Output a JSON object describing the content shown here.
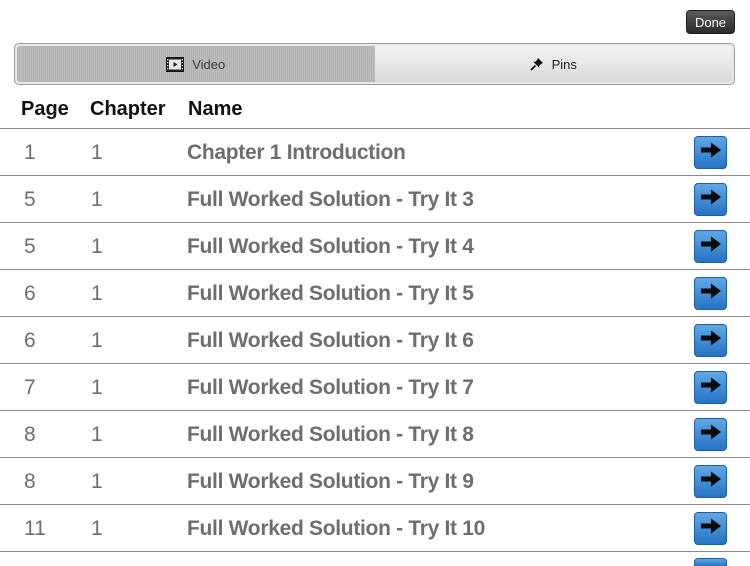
{
  "toolbar": {
    "done_label": "Done"
  },
  "tabs": [
    {
      "label": "Video",
      "icon": "video-icon",
      "active": true
    },
    {
      "label": "Pins",
      "icon": "pin-icon",
      "active": false
    }
  ],
  "table": {
    "columns": [
      "Page",
      "Chapter",
      "Name"
    ],
    "rows": [
      {
        "page": "1",
        "chapter": "1",
        "name": "Chapter 1 Introduction"
      },
      {
        "page": "5",
        "chapter": "1",
        "name": "Full Worked Solution - Try It 3"
      },
      {
        "page": "5",
        "chapter": "1",
        "name": "Full Worked Solution - Try It 4"
      },
      {
        "page": "6",
        "chapter": "1",
        "name": "Full Worked Solution - Try It 5"
      },
      {
        "page": "6",
        "chapter": "1",
        "name": "Full Worked Solution - Try It 6"
      },
      {
        "page": "7",
        "chapter": "1",
        "name": "Full Worked Solution - Try It 7"
      },
      {
        "page": "8",
        "chapter": "1",
        "name": "Full Worked Solution - Try It 8"
      },
      {
        "page": "8",
        "chapter": "1",
        "name": "Full Worked Solution - Try It 9"
      },
      {
        "page": "11",
        "chapter": "1",
        "name": "Full Worked Solution - Try It 10"
      }
    ]
  },
  "colors": {
    "accent": "#2773c4",
    "text_muted": "#6e6e6e",
    "header_text": "#111111"
  }
}
